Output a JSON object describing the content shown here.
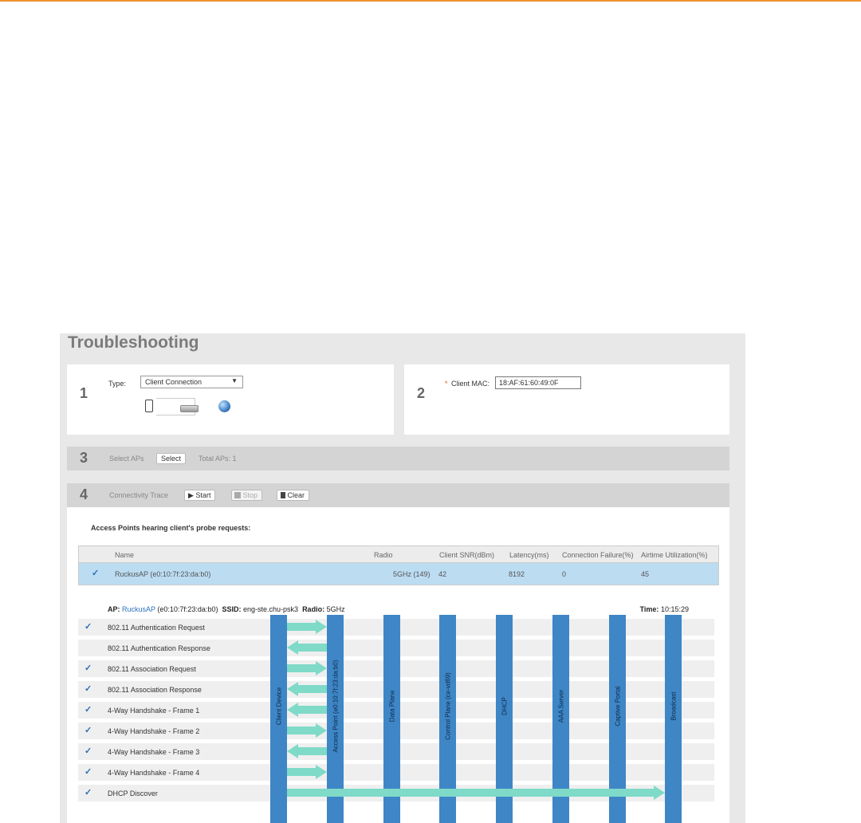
{
  "page": {
    "title": "Troubleshooting"
  },
  "step1": {
    "number": "1",
    "type_label": "Type:",
    "type_value": "Client Connection",
    "icons": [
      "phone-icon",
      "access-point-icon",
      "globe-icon"
    ]
  },
  "step2": {
    "number": "2",
    "required_mark": "*",
    "mac_label": "Client MAC:",
    "mac_value": "18:AF:61:60:49:0F"
  },
  "step3": {
    "number": "3",
    "label": "Select APs",
    "select_button": "Select",
    "total": "Total APs: 1"
  },
  "step4": {
    "number": "4",
    "label": "Connectivity Trace",
    "start_button": "Start",
    "stop_button": "Stop",
    "clear_button": "Clear",
    "probe_heading": "Access Points hearing client's probe requests:",
    "table": {
      "columns": [
        "Name",
        "Radio",
        "Client SNR(dBm)",
        "Latency(ms)",
        "Connection Failure(%)",
        "Airtime Utilization(%)"
      ],
      "rows": [
        {
          "selected": true,
          "name": "RuckusAP (e0:10:7f:23:da:b0)",
          "radio": "5GHz (149)",
          "snr": "42",
          "latency": "8192",
          "failure": "0",
          "airtime": "45"
        }
      ]
    },
    "trace_info": {
      "ap_label": "AP:",
      "ap_link": "RuckusAP",
      "ap_mac": "(e0:10:7f:23:da:b0)",
      "ssid_label": "SSID:",
      "ssid_value": "eng-ste.chu-psk3",
      "radio_label": "Radio:",
      "radio_value": "5GHz",
      "time_label": "Time:",
      "time_value": "10:15:29"
    },
    "lanes": [
      "Client Device",
      "Access Point (e0:10:7f:23:da:b0)",
      "Data Plane",
      "Control Plane (ce-vd69)",
      "DHCP",
      "AAA Server",
      "Captive Portal",
      "Broadcast"
    ],
    "steps": [
      {
        "label": "802.11 Authentication Request",
        "status": "✓"
      },
      {
        "label": "802.11 Authentication Response",
        "status": ""
      },
      {
        "label": "802.11 Association Request",
        "status": "✓"
      },
      {
        "label": "802.11 Association Response",
        "status": "✓"
      },
      {
        "label": "4-Way Handshake - Frame 1",
        "status": "✓"
      },
      {
        "label": "4-Way Handshake - Frame 2",
        "status": "✓"
      },
      {
        "label": "4-Way Handshake - Frame 3",
        "status": "✓"
      },
      {
        "label": "4-Way Handshake - Frame 4",
        "status": "✓"
      },
      {
        "label": "DHCP Discover",
        "status": "✓"
      }
    ],
    "arrow_color": "#7fdac8",
    "lane_color": "#3e86c6"
  }
}
